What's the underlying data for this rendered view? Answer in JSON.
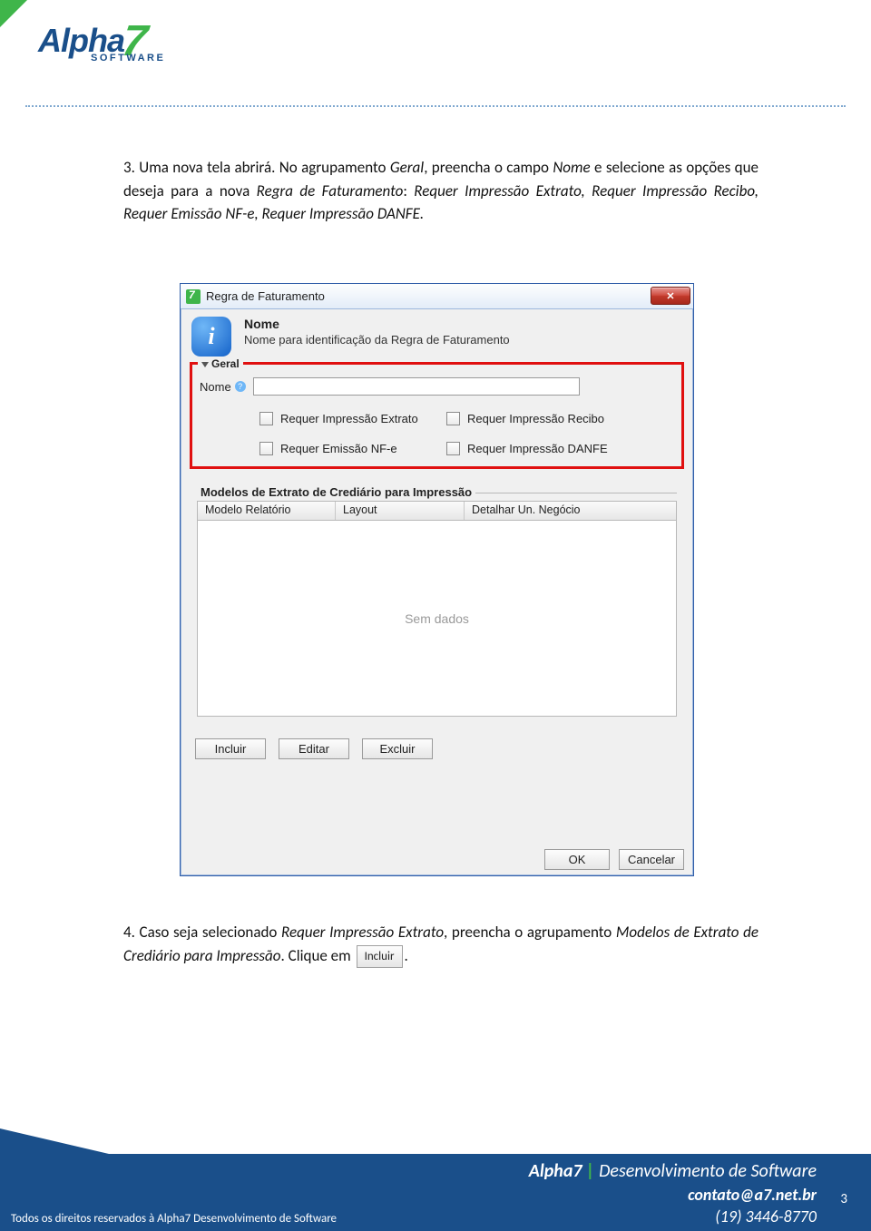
{
  "header": {
    "brand": "Alpha",
    "brand_sub": "SOFTWARE"
  },
  "doc": {
    "step3": "3. Uma nova tela abrirá. No agrupamento <em>Geral</em>, preencha o campo <em>Nome</em> e selecione as opções que deseja para a nova <em>Regra de Faturamento</em>: <em>Requer Impressão Extrato, Requer Impressão Recibo, Requer Emissão NF-e, Requer Impressão DANFE.</em>",
    "step4a": "4. Caso seja selecionado <em>Requer Impressão Extrato</em>, preencha o agrupamento <em>Modelos de Extrato de Crediário para Impressão</em>. Clique em",
    "step4b": ".",
    "inline_btn": "Incluir"
  },
  "dialog": {
    "title": "Regra de Faturamento",
    "info_title": "Nome",
    "info_desc": "Nome para identificação da Regra de Faturamento",
    "geral_label": "Geral",
    "nome_label": "Nome",
    "nome_value": "",
    "checks": {
      "extrato": "Requer Impressão Extrato",
      "recibo": "Requer Impressão Recibo",
      "nfe": "Requer Emissão NF-e",
      "danfe": "Requer Impressão DANFE"
    },
    "modelos_label": "Modelos de Extrato de Crediário para Impressão",
    "columns": {
      "c1": "Modelo Relatório",
      "c2": "Layout",
      "c3": "Detalhar Un. Negócio"
    },
    "empty": "Sem dados",
    "buttons": {
      "incluir": "Incluir",
      "editar": "Editar",
      "excluir": "Excluir"
    },
    "footer": {
      "ok": "OK",
      "cancel": "Cancelar"
    }
  },
  "footer": {
    "left": "Todos os direitos reservados à Alpha7 Desenvolvimento de Software",
    "company": "Alpha7",
    "tagline": "Desenvolvimento de Software",
    "email": "contato@a7.net.br",
    "phone": "(19) 3446-8770",
    "page": "3"
  }
}
